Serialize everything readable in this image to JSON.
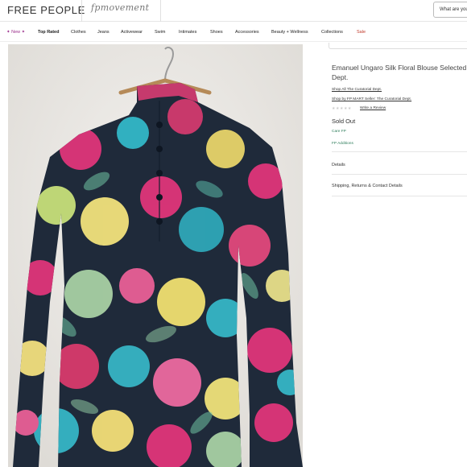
{
  "header": {
    "logo": "FREE PEOPLE",
    "sub_brand": "fpmovement",
    "search_placeholder": "What are you"
  },
  "nav": {
    "items": [
      {
        "label": "✦ New ✦"
      },
      {
        "label": "Top Rated"
      },
      {
        "label": "Clothes"
      },
      {
        "label": "Jeans"
      },
      {
        "label": "Activewear"
      },
      {
        "label": "Swim"
      },
      {
        "label": "Intimates"
      },
      {
        "label": "Shoes"
      },
      {
        "label": "Accessories"
      },
      {
        "label": "Beauty + Wellness"
      },
      {
        "label": "Collections"
      },
      {
        "label": "Sale"
      }
    ]
  },
  "product": {
    "title": "Emanuel Ungaro Silk Floral Blouse Selected Dept.",
    "shop_all_link": "Shop All The Curatorial Dept.",
    "shop_by_link": "Shop by FP MART Seller: The Curatorial Dept.",
    "stars": "★★★★★",
    "write_review": "Write a Review",
    "status": "Sold Out",
    "care": "Care FP",
    "additions": "FP Additions",
    "sections": [
      "Details",
      "Shipping, Returns & Contact Details"
    ]
  },
  "colors": {
    "accent_new": "#9b2f8c",
    "sale": "#c0392b",
    "care_green": "#2e7d5b"
  },
  "icons": [
    "star-icon"
  ]
}
